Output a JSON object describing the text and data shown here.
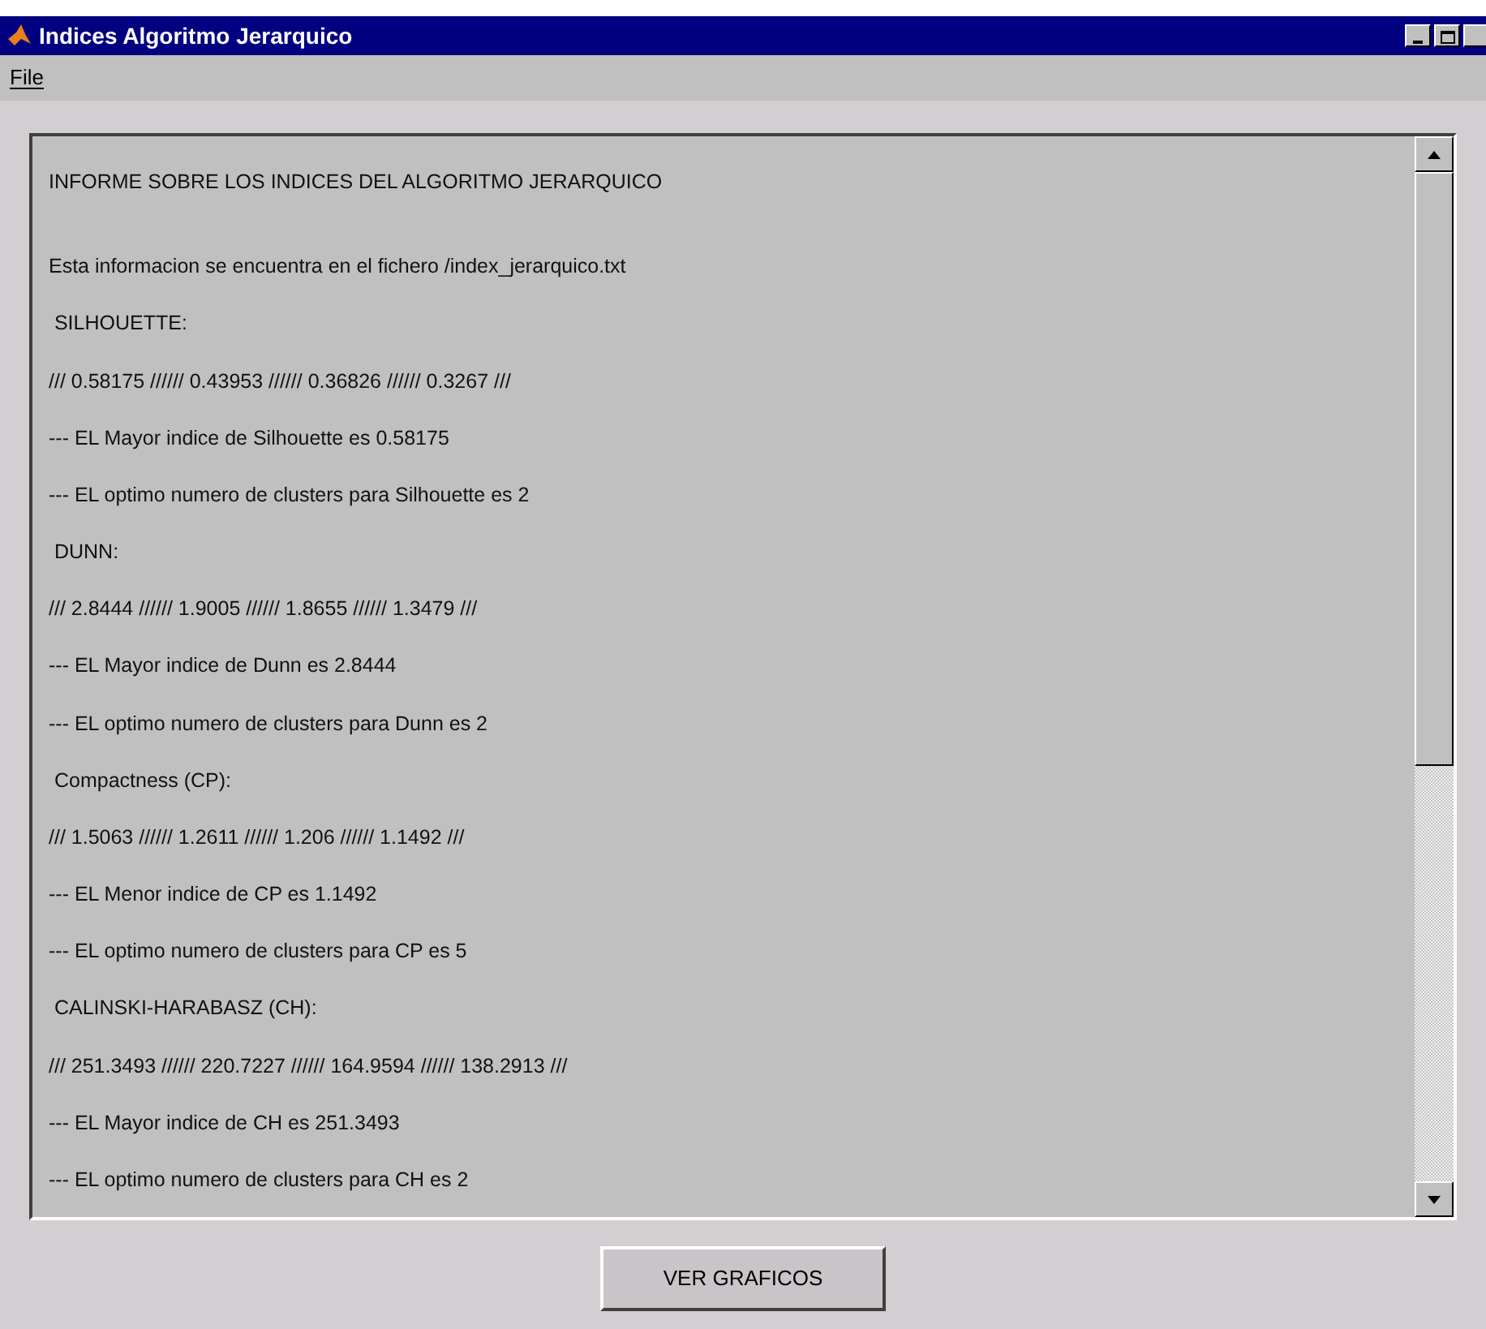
{
  "window": {
    "title": "Indices Algoritmo Jerarquico"
  },
  "menu": [
    {
      "label": "File"
    }
  ],
  "report": {
    "lines": [
      "INFORME SOBRE LOS INDICES DEL ALGORITMO JERARQUICO",
      "Esta informacion se encuentra en el fichero /index_jerarquico.txt",
      " SILHOUETTE:",
      "/// 0.58175 ////// 0.43953 ////// 0.36826 ////// 0.3267 ///",
      "--- EL Mayor indice de Silhouette es 0.58175",
      "--- EL optimo numero de clusters para Silhouette es 2",
      " DUNN:",
      "/// 2.8444 ////// 1.9005 ////// 1.8655 ////// 1.3479 ///",
      "--- EL Mayor indice de Dunn es 2.8444",
      "--- EL optimo numero de clusters para Dunn es 2",
      " Compactness (CP):",
      "/// 1.5063 ////// 1.2611 ////// 1.206 ////// 1.1492 ///",
      "--- EL Menor indice de CP es 1.1492",
      "--- EL optimo numero de clusters para CP es 5",
      " CALINSKI-HARABASZ (CH):",
      "/// 251.3493 ////// 220.7227 ////// 164.9594 ////// 138.2913 ///",
      "--- EL Mayor indice de CH es 251.3493",
      "--- EL optimo numero de clusters para CH es 2"
    ]
  },
  "buttons": [
    {
      "label": "VER GRAFICOS"
    }
  ]
}
